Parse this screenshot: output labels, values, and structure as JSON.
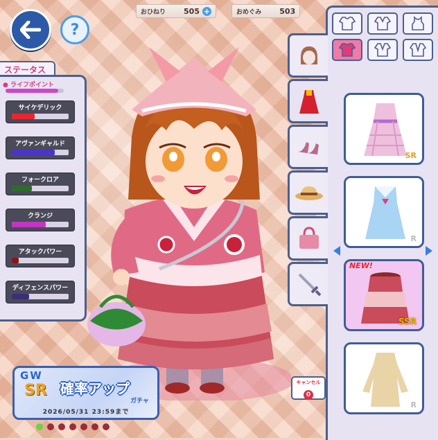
{
  "currencies": [
    {
      "label": "おひねり",
      "value": "505",
      "has_plus": true
    },
    {
      "label": "おめぐみ",
      "value": "503",
      "has_plus": false
    }
  ],
  "status": {
    "title": "ステータス",
    "life_point_label": "ライフポイント",
    "life_point_fraction": 0.9,
    "stats": [
      {
        "name": "サイケデリック",
        "fraction": 0.4,
        "color": "#e8262e"
      },
      {
        "name": "アヴァンギャルド",
        "fraction": 0.75,
        "color": "#4a35c8"
      },
      {
        "name": "フォークロア",
        "fraction": 0.35,
        "color": "#2f6b2c"
      },
      {
        "name": "クランジ",
        "fraction": 0.6,
        "color": "#c335c4"
      },
      {
        "name": "アタックパワー",
        "fraction": 0.12,
        "color": "#8e1414"
      },
      {
        "name": "ディフェンスパワー",
        "fraction": 0.3,
        "color": "#3c2f78"
      }
    ]
  },
  "wardrobe": {
    "items": [
      {
        "rarity": "SR",
        "new": false,
        "selected": false,
        "icon": "pink-plaid-dress-icon"
      },
      {
        "rarity": "R",
        "new": false,
        "selected": false,
        "icon": "blue-sailor-dress-icon"
      },
      {
        "rarity": "SSR",
        "new": true,
        "new_label": "NEW!",
        "selected": true,
        "icon": "red-tiered-skirt-icon"
      },
      {
        "rarity": "R",
        "new": false,
        "selected": false,
        "icon": "beige-dress-icon"
      }
    ],
    "cancel_label": "キャンセル",
    "cancel_count": "0"
  },
  "banner": {
    "gw": "GW",
    "sr": "SR",
    "headline": "確率アップ",
    "sub": "ガチャ",
    "date": "2026/05/31 23:59まで"
  },
  "pager": {
    "count": 7,
    "active": 0
  }
}
